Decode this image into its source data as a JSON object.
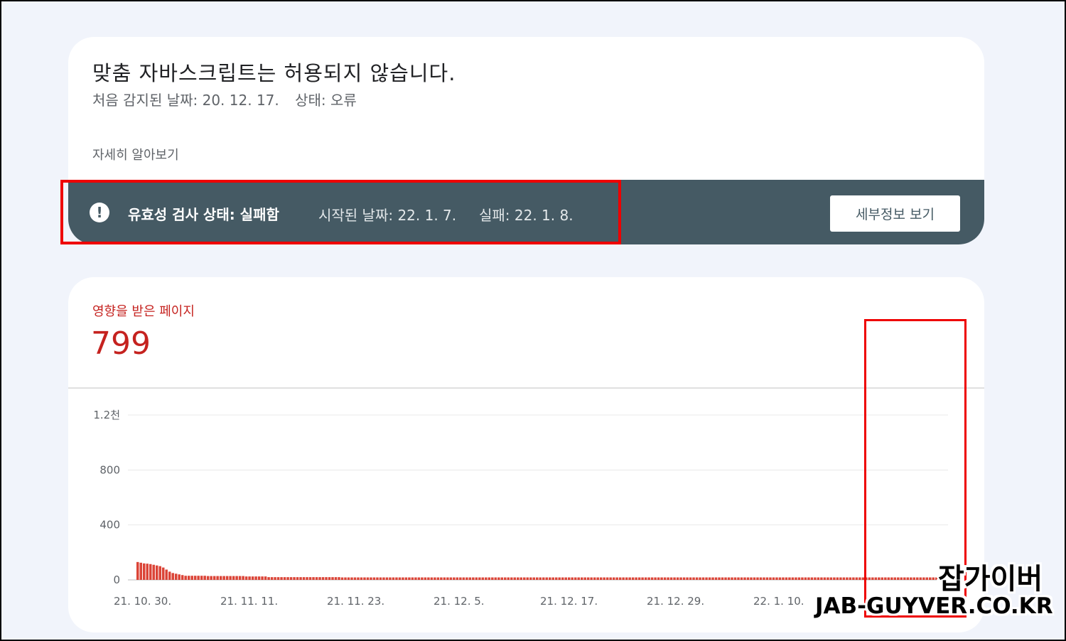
{
  "issue": {
    "title": "맞춤 자바스크립트는 허용되지 않습니다.",
    "first_detected": "처음 감지된 날짜: 20. 12. 17.",
    "status": "상태: 오류",
    "learn_more": "자세히 알아보기"
  },
  "validation": {
    "status": "유효성 검사 상태: 실패함",
    "started": "시작된 날짜: 22. 1. 7.",
    "failed": "실패: 22. 1. 8.",
    "details_button": "세부정보 보기",
    "bar_color": "#455a64"
  },
  "metric": {
    "label": "영향을 받은 페이지",
    "value": "799",
    "color": "#c5221f"
  },
  "chart_data": {
    "type": "bar",
    "ylim": [
      0,
      1200
    ],
    "yticks": [
      {
        "value": 0,
        "label": "0"
      },
      {
        "value": 400,
        "label": "400"
      },
      {
        "value": 800,
        "label": "800"
      },
      {
        "value": 1200,
        "label": "1.2천"
      }
    ],
    "xtick_labels": [
      "21. 10. 30.",
      "21. 11. 11.",
      "21. 11. 23.",
      "21. 12. 5.",
      "21. 12. 17.",
      "21. 12. 29.",
      "22. 1. 10."
    ],
    "bar_color": "#db4437",
    "grid": true,
    "values": [
      130,
      125,
      120,
      118,
      115,
      110,
      105,
      100,
      90,
      75,
      60,
      50,
      45,
      40,
      35,
      30,
      30,
      30,
      30,
      30,
      30,
      30,
      28,
      28,
      28,
      28,
      28,
      28,
      28,
      28,
      28,
      28,
      28,
      28,
      25,
      25,
      25,
      25,
      25,
      25,
      25,
      20,
      20,
      20,
      20,
      20,
      20,
      20,
      20,
      20,
      20,
      20,
      20,
      20,
      20,
      20,
      20,
      20,
      20,
      20,
      20,
      20,
      20,
      20,
      18,
      18,
      18,
      18,
      18,
      18,
      18,
      18,
      18,
      18,
      18,
      18,
      18,
      18,
      18,
      18,
      18,
      18,
      18,
      18,
      18,
      18,
      18,
      18,
      18,
      18,
      18,
      18,
      18,
      18,
      18,
      18,
      18,
      18,
      18,
      18,
      18,
      18,
      18,
      18,
      18,
      18,
      18,
      18,
      18,
      18,
      18,
      18,
      18,
      18,
      18,
      18,
      18,
      18,
      18,
      18,
      18,
      18,
      18,
      18,
      18,
      18,
      18,
      18,
      18,
      18,
      18,
      18,
      18,
      18,
      18,
      18,
      18,
      18,
      18,
      18,
      18,
      18,
      18,
      18,
      18,
      18,
      18,
      18,
      18,
      18,
      18,
      18,
      18,
      18,
      18,
      18,
      18,
      18,
      18,
      18,
      18,
      18,
      18,
      18,
      18,
      18,
      18,
      18,
      18,
      18,
      18,
      18,
      18,
      18,
      18,
      18,
      18,
      18,
      18,
      18,
      18,
      18,
      18,
      18,
      18,
      18,
      18,
      18,
      18,
      18,
      18,
      18,
      18,
      18,
      18,
      18,
      18,
      18,
      18,
      18,
      18,
      18,
      18,
      18,
      18,
      18,
      18,
      18,
      18,
      18,
      18,
      18,
      18,
      18,
      18,
      18,
      18,
      18,
      18,
      18,
      18,
      18,
      18,
      18,
      18,
      18,
      18,
      18,
      18,
      18,
      18,
      18,
      18,
      18,
      18,
      18,
      18,
      18,
      18,
      18,
      18,
      18,
      18,
      18,
      18,
      18,
      18,
      18,
      18,
      18,
      18,
      18,
      18,
      18
    ]
  },
  "watermark": {
    "korean": "잡가이버",
    "site": "JAB-GUYVER.CO.KR"
  }
}
